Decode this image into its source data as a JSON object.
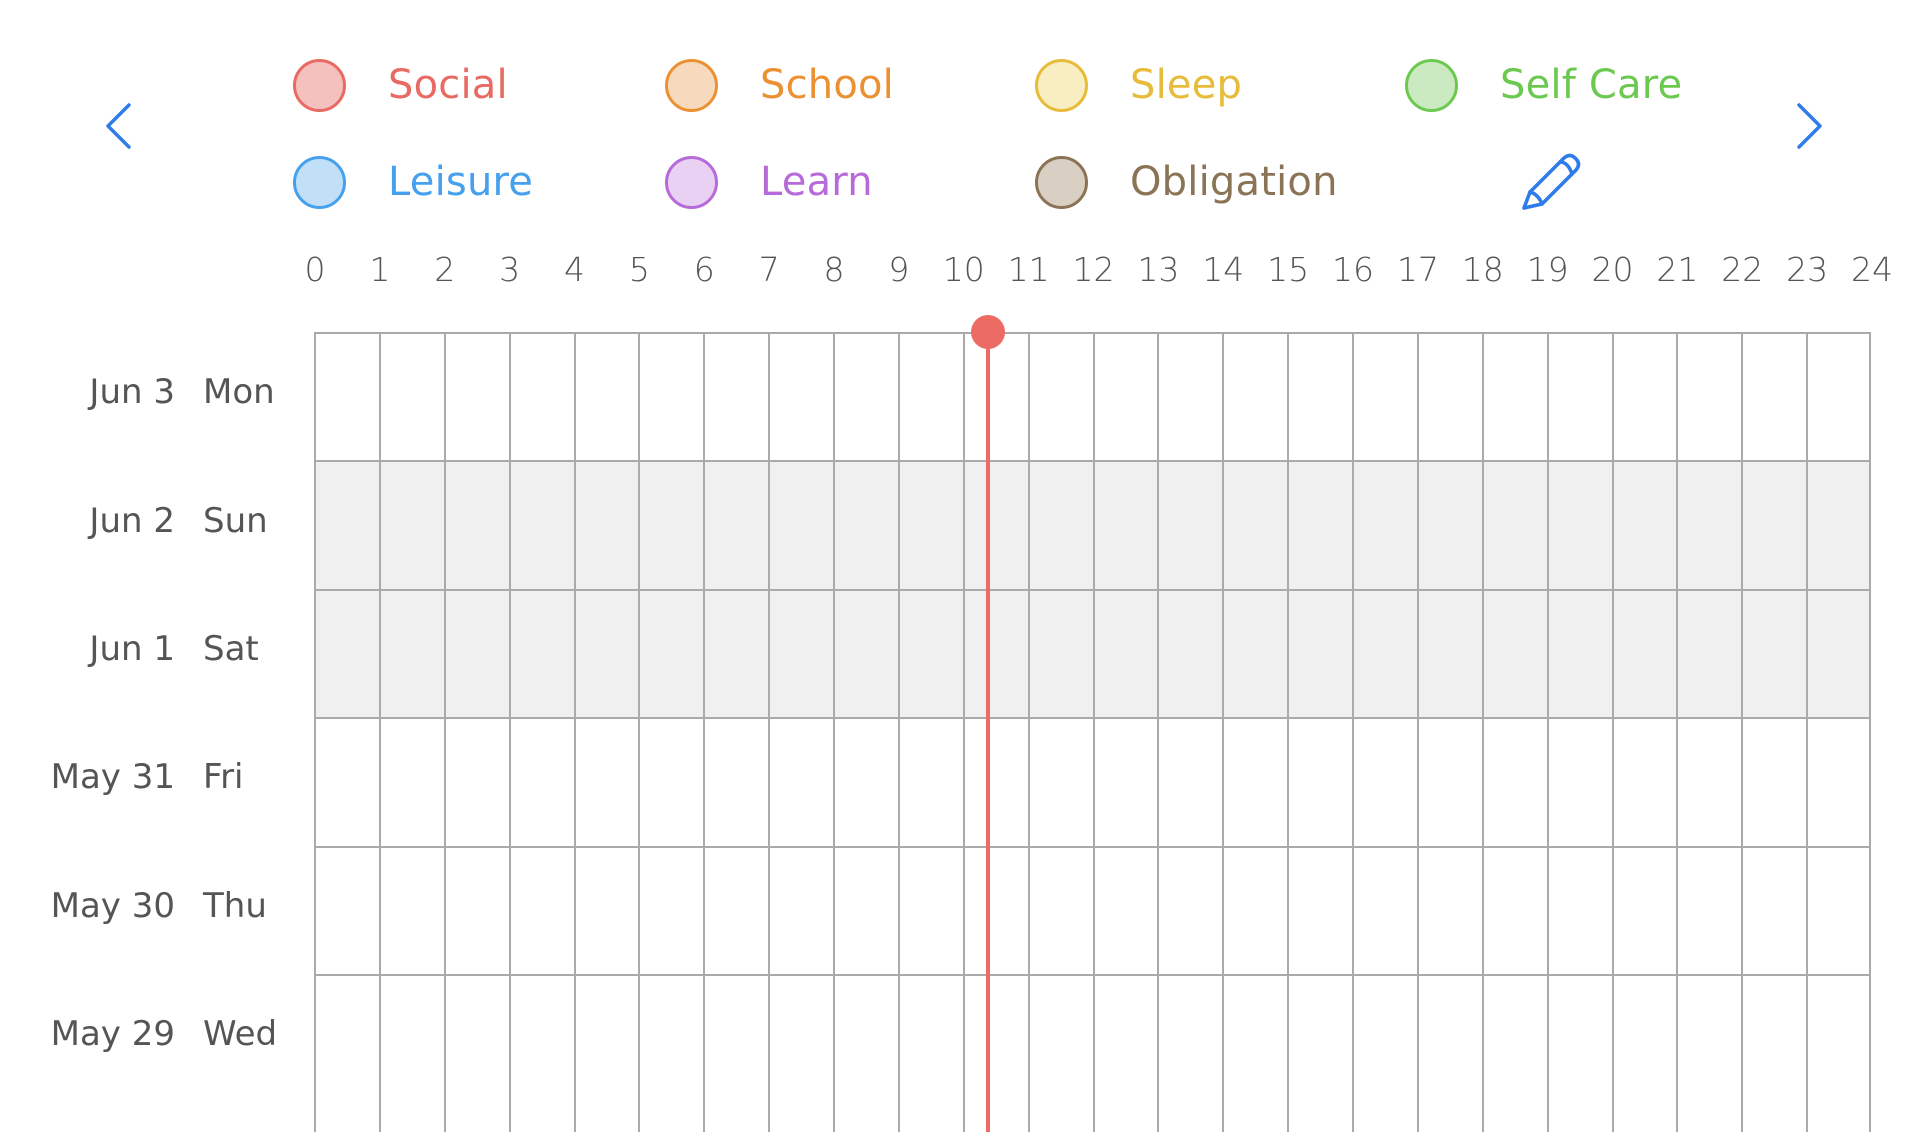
{
  "navigation": {
    "prev_label": "Previous week",
    "next_label": "Next week",
    "prev_icon": "chevron-left-icon",
    "next_icon": "chevron-right-icon",
    "accent_color": "#2f7bea"
  },
  "legend": {
    "edit_icon": "pencil-icon",
    "categories": [
      {
        "name": "Social",
        "text_color": "#e96a63",
        "fill": "#f5c1bf",
        "stroke": "#e96a63"
      },
      {
        "name": "School",
        "text_color": "#ec9133",
        "fill": "#f7dabd",
        "stroke": "#ec9133"
      },
      {
        "name": "Sleep",
        "text_color": "#e7bc3a",
        "fill": "#f9edc2",
        "stroke": "#e7bc3a"
      },
      {
        "name": "Self Care",
        "text_color": "#6cc94f",
        "fill": "#cbeac1",
        "stroke": "#6cc94f"
      },
      {
        "name": "Leisure",
        "text_color": "#46a0ee",
        "fill": "#c1e0f7",
        "stroke": "#46a0ee"
      },
      {
        "name": "Learn",
        "text_color": "#b76ad9",
        "fill": "#e8d1f2",
        "stroke": "#b76ad9"
      },
      {
        "name": "Obligation",
        "text_color": "#8a7455",
        "fill": "#d9cfc2",
        "stroke": "#8a7455"
      }
    ]
  },
  "timeline": {
    "hours": [
      "0",
      "1",
      "2",
      "3",
      "4",
      "5",
      "6",
      "7",
      "8",
      "9",
      "10",
      "11",
      "12",
      "13",
      "14",
      "15",
      "16",
      "17",
      "18",
      "19",
      "20",
      "21",
      "22",
      "23",
      "24"
    ],
    "current_time_hours": 10.37,
    "current_time_color": "#ec6b65",
    "days": [
      {
        "date": "Jun 3",
        "weekday": "Mon",
        "weekend": false
      },
      {
        "date": "Jun 2",
        "weekday": "Sun",
        "weekend": true
      },
      {
        "date": "Jun 1",
        "weekday": "Sat",
        "weekend": true
      },
      {
        "date": "May 31",
        "weekday": "Fri",
        "weekend": false
      },
      {
        "date": "May 30",
        "weekday": "Thu",
        "weekend": false
      },
      {
        "date": "May 29",
        "weekday": "Wed",
        "weekend": false
      }
    ]
  }
}
